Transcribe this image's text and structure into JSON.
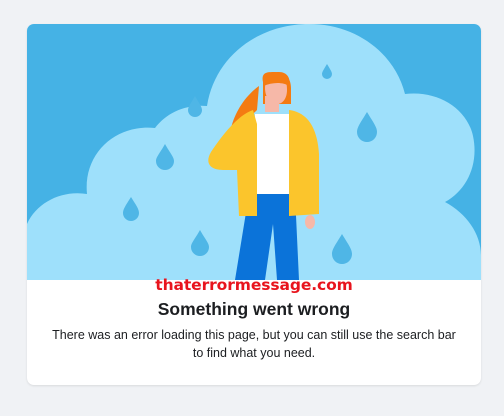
{
  "watermark": "thaterrormessage.com",
  "error": {
    "title": "Something went wrong",
    "message": "There was an error loading this page, but you can still use the search bar to find what you need."
  },
  "colors": {
    "page_background": "#f0f2f5",
    "sky": "#45b2e5",
    "cloud": "#9ee0fb",
    "raindrop": "#4fb6e6",
    "jacket": "#fbc52c",
    "jeans": "#0b73d9",
    "hair": "#f47b12",
    "skin": "#f6b8a8",
    "watermark": "#e8141d"
  },
  "icons": [
    "raindrop-icon",
    "person-illustration"
  ]
}
